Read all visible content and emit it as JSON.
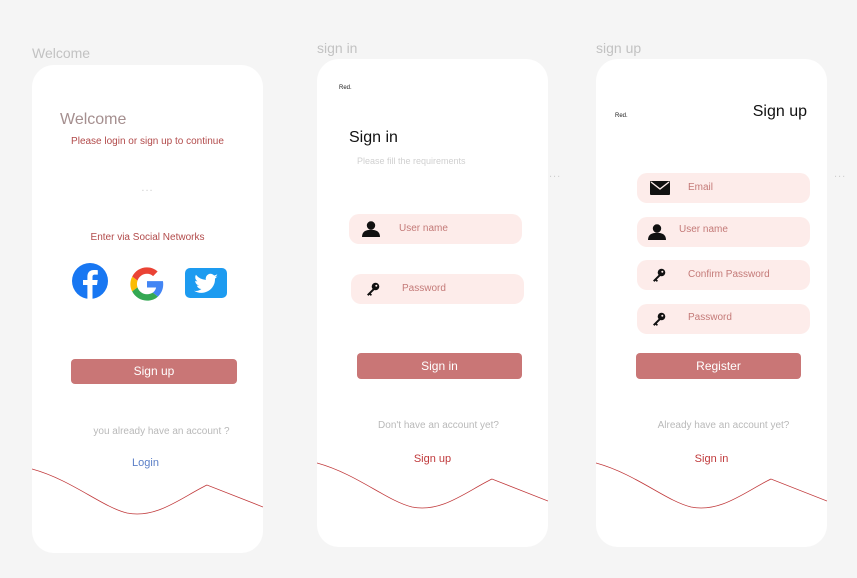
{
  "welcome_screen": {
    "frame_label": "Welcome",
    "title": "Welcome",
    "subtitle": "Please login or sign up to continue",
    "dots": "...",
    "social_heading": "Enter via Social Networks",
    "social_icons": [
      "facebook-icon",
      "google-icon",
      "twitter-icon"
    ],
    "signup_button": "Sign up",
    "account_prompt": "you already have an account ?",
    "login_link": "Login"
  },
  "signin_screen": {
    "frame_label": "sign in",
    "logo": "Red.",
    "title": "Sign in",
    "subtitle": "Please fill the requirements",
    "username_placeholder": "User name",
    "password_placeholder": "Password",
    "signin_button": "Sign in",
    "no_account_prompt": "Don't have an account yet?",
    "signup_link": "Sign up",
    "side_dots": "..."
  },
  "signup_screen": {
    "frame_label": "sign up",
    "logo": "Red.",
    "title": "Sign up",
    "email_placeholder": "Email",
    "username_placeholder": "User name",
    "confirm_password_placeholder": "Confirm Password",
    "password_placeholder": "Password",
    "register_button": "Register",
    "have_account_prompt": "Already have an account yet?",
    "signin_link": "Sign in",
    "side_dots": "..."
  },
  "colors": {
    "accent": "#c97676",
    "field_bg": "#fdecea",
    "link_blue": "#5b7fc7",
    "link_red": "#c0393b",
    "facebook": "#1877f2",
    "twitter": "#1d9bf0"
  }
}
